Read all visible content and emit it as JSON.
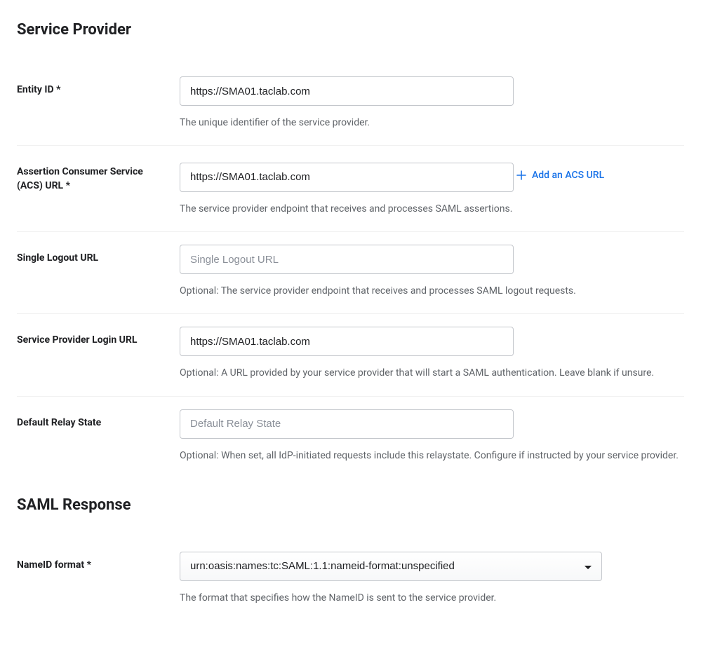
{
  "sections": {
    "service_provider": {
      "heading": "Service Provider",
      "entity_id": {
        "label": "Entity ID *",
        "value": "https://SMA01.taclab.com",
        "help": "The unique identifier of the service provider."
      },
      "acs_url": {
        "label": "Assertion Consumer Service (ACS) URL *",
        "value": "https://SMA01.taclab.com",
        "add_link": "Add an ACS URL",
        "help": "The service provider endpoint that receives and processes SAML assertions."
      },
      "single_logout_url": {
        "label": "Single Logout URL",
        "value": "",
        "placeholder": "Single Logout URL",
        "help": "Optional: The service provider endpoint that receives and processes SAML logout requests."
      },
      "sp_login_url": {
        "label": "Service Provider Login URL",
        "value": "https://SMA01.taclab.com",
        "help": "Optional: A URL provided by your service provider that will start a SAML authentication. Leave blank if unsure."
      },
      "default_relay_state": {
        "label": "Default Relay State",
        "value": "",
        "placeholder": "Default Relay State",
        "help": "Optional: When set, all IdP-initiated requests include this relaystate. Configure if instructed by your service provider."
      }
    },
    "saml_response": {
      "heading": "SAML Response",
      "nameid_format": {
        "label": "NameID format  *",
        "value": "urn:oasis:names:tc:SAML:1.1:nameid-format:unspecified",
        "help": "The format that specifies how the NameID is sent to the service provider."
      }
    }
  }
}
